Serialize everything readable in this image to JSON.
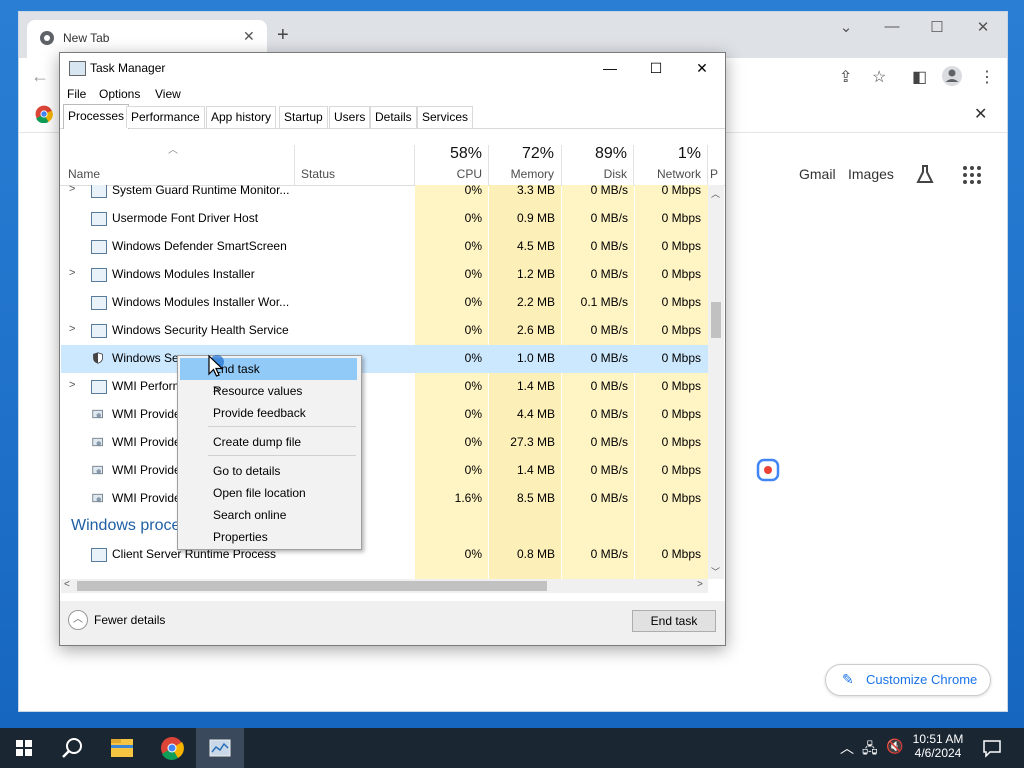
{
  "browser": {
    "tab_title": "New Tab",
    "links": [
      "Gmail",
      "Images"
    ],
    "customize_label": "Customize Chrome"
  },
  "task_manager": {
    "title": "Task Manager",
    "menu": [
      "File",
      "Options",
      "View"
    ],
    "tabs": [
      "Processes",
      "Performance",
      "App history",
      "Startup",
      "Users",
      "Details",
      "Services"
    ],
    "active_tab": "Processes",
    "columns": {
      "name": "Name",
      "status": "Status",
      "cpu": {
        "pct": "58%",
        "label": "CPU"
      },
      "memory": {
        "pct": "72%",
        "label": "Memory"
      },
      "disk": {
        "pct": "89%",
        "label": "Disk"
      },
      "network": {
        "pct": "1%",
        "label": "Network"
      },
      "power": "P"
    },
    "rows": [
      {
        "name": "System Guard Runtime Monitor...",
        "expand": true,
        "icon": "service",
        "cpu": "0%",
        "memory": "3.3 MB",
        "disk": "0 MB/s",
        "network": "0 Mbps"
      },
      {
        "name": "Usermode Font Driver Host",
        "expand": false,
        "icon": "service",
        "cpu": "0%",
        "memory": "0.9 MB",
        "disk": "0 MB/s",
        "network": "0 Mbps"
      },
      {
        "name": "Windows Defender SmartScreen",
        "expand": false,
        "icon": "service",
        "cpu": "0%",
        "memory": "4.5 MB",
        "disk": "0 MB/s",
        "network": "0 Mbps"
      },
      {
        "name": "Windows Modules Installer",
        "expand": true,
        "icon": "service",
        "cpu": "0%",
        "memory": "1.2 MB",
        "disk": "0 MB/s",
        "network": "0 Mbps"
      },
      {
        "name": "Windows Modules Installer Wor...",
        "expand": false,
        "icon": "service",
        "cpu": "0%",
        "memory": "2.2 MB",
        "disk": "0.1 MB/s",
        "network": "0 Mbps"
      },
      {
        "name": "Windows Security Health Service",
        "expand": true,
        "icon": "service",
        "cpu": "0%",
        "memory": "2.6 MB",
        "disk": "0 MB/s",
        "network": "0 Mbps"
      },
      {
        "name": "Windows Sec",
        "expand": false,
        "icon": "shield",
        "cpu": "0%",
        "memory": "1.0 MB",
        "disk": "0 MB/s",
        "network": "0 Mbps",
        "selected": true
      },
      {
        "name": "WMI Perform",
        "expand": true,
        "icon": "service",
        "cpu": "0%",
        "memory": "1.4 MB",
        "disk": "0 MB/s",
        "network": "0 Mbps"
      },
      {
        "name": "WMI Provide",
        "expand": false,
        "icon": "gear",
        "cpu": "0%",
        "memory": "4.4 MB",
        "disk": "0 MB/s",
        "network": "0 Mbps"
      },
      {
        "name": "WMI Provide",
        "expand": false,
        "icon": "gear",
        "cpu": "0%",
        "memory": "27.3 MB",
        "disk": "0 MB/s",
        "network": "0 Mbps"
      },
      {
        "name": "WMI Provide",
        "expand": false,
        "icon": "gear",
        "cpu": "0%",
        "memory": "1.4 MB",
        "disk": "0 MB/s",
        "network": "0 Mbps"
      },
      {
        "name": "WMI Provide",
        "expand": false,
        "icon": "gear",
        "cpu": "1.6%",
        "memory": "8.5 MB",
        "disk": "0 MB/s",
        "network": "0 Mbps"
      }
    ],
    "group_label": "Windows proce",
    "last_row": {
      "name": "Client Server Runtime Process",
      "icon": "service",
      "cpu": "0%",
      "memory": "0.8 MB",
      "disk": "0 MB/s",
      "network": "0 Mbps"
    },
    "fewer_details": "Fewer details",
    "end_task_button": "End task"
  },
  "context_menu": {
    "items": [
      "End task",
      "Resource values",
      "Provide feedback",
      "Create dump file",
      "Go to details",
      "Open file location",
      "Search online",
      "Properties"
    ],
    "highlighted": "End task"
  },
  "taskbar": {
    "time": "10:51 AM",
    "date": "4/6/2024"
  },
  "colors": {
    "selection": "#cce8ff",
    "menu_highlight": "#91c9f7",
    "heat": "#fff4c4",
    "link_blue": "#1a73e8"
  }
}
